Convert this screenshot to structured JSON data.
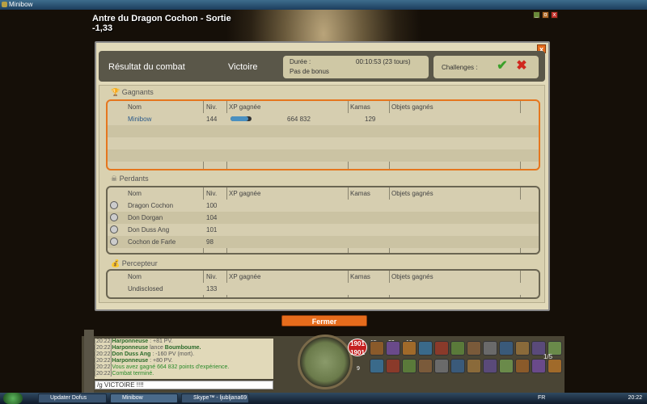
{
  "window": {
    "title": "Minibow"
  },
  "map": {
    "title": "Antre du Dragon Cochon - Sortie",
    "coords": "-1,33"
  },
  "dialog": {
    "title": "Résultat du combat",
    "result": "Victoire",
    "duration_label": "Durée :",
    "duration_value": "00:10:53 (23 tours)",
    "bonus": "Pas de bonus",
    "challenges_label": "Challenges :",
    "close": "x",
    "columns": [
      "Nom",
      "Niv.",
      "XP gagnée",
      "Kamas",
      "Objets gagnés"
    ],
    "winners": {
      "title": "Gagnants",
      "rows": [
        {
          "name": "Minibow",
          "level": "144",
          "xp": "664 832",
          "xp_fill": 0.85,
          "kamas": "129"
        }
      ]
    },
    "losers": {
      "title": "Perdants",
      "rows": [
        {
          "name": "Dragon Cochon",
          "level": "100"
        },
        {
          "name": "Don Dorgan",
          "level": "104"
        },
        {
          "name": "Don Duss Ang",
          "level": "101"
        },
        {
          "name": "Cochon de Farle",
          "level": "98"
        }
      ]
    },
    "collector": {
      "title": "Percepteur",
      "rows": [
        {
          "name": "Undisclosed",
          "level": "133"
        }
      ]
    },
    "close_button": "Fermer"
  },
  "chat": {
    "lines": [
      {
        "time": "[20:22]",
        "actor": "Harponneuse",
        "text": " : +81 PV."
      },
      {
        "time": "[20:22]",
        "actor": "Harponneuse",
        "text": " lance ",
        "spell": "Boumboume."
      },
      {
        "time": "[20:22]",
        "actor": "Don Duss Ang",
        "text": " : -160 PV (mort)."
      },
      {
        "time": "[20:22]",
        "actor": "Harponneuse",
        "text": " : +80 PV."
      },
      {
        "time": "[20:22]",
        "text": "Vous avez gagné 664 832 points d'expérience."
      },
      {
        "time": "[20:22]",
        "text": "Combat terminé."
      }
    ],
    "input": "/g VICTOIRE !!!!"
  },
  "hud": {
    "life_current": "1901",
    "life_max": "1901",
    "ap": "15",
    "mp": "9",
    "stat_a": "33",
    "stat_b": "10",
    "page": "1/5"
  },
  "taskbar": {
    "items": [
      "Updater Dofus",
      "Minibow",
      "Skype™ - ljubljana69"
    ],
    "lang": "FR",
    "clock": "20:22"
  },
  "colors": {
    "accent": "#e66c1c",
    "dialog_bg": "#e1d9b9",
    "header_bg": "#5a5749"
  }
}
